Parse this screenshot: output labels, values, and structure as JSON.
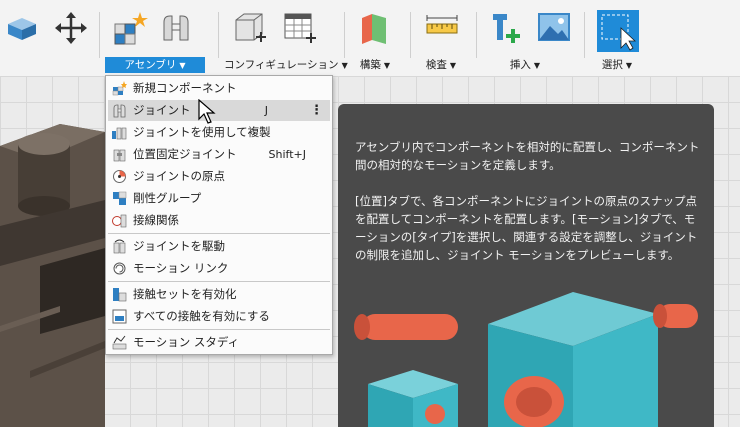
{
  "toolbar": {
    "groups": [
      {
        "label": "アセンブリ",
        "active": true
      },
      {
        "label": "コンフィギュレーション",
        "active": false
      },
      {
        "label": "構築",
        "active": false
      },
      {
        "label": "検査",
        "active": false
      },
      {
        "label": "挿入",
        "active": false
      },
      {
        "label": "選択",
        "active": false
      }
    ],
    "icons": [
      "new-body-icon",
      "move-icon",
      "new-component-icon",
      "joint-icon",
      "configuration-icon",
      "configuration-table-icon",
      "construct-icon",
      "measure-icon",
      "insert-derive-icon",
      "insert-image-icon",
      "select-window-icon"
    ]
  },
  "menu": {
    "items": [
      {
        "label": "新規コンポーネント",
        "shortcut": "",
        "icon": "new-component-icon"
      },
      {
        "label": "ジョイント",
        "shortcut": "J",
        "icon": "joint-icon"
      },
      {
        "label": "ジョイントを使用して複製",
        "shortcut": "",
        "icon": "duplicate-with-joints-icon"
      },
      {
        "label": "位置固定ジョイント",
        "shortcut": "Shift+J",
        "icon": "as-built-joint-icon"
      },
      {
        "label": "ジョイントの原点",
        "shortcut": "",
        "icon": "joint-origin-icon"
      },
      {
        "label": "剛性グループ",
        "shortcut": "",
        "icon": "rigid-group-icon"
      },
      {
        "label": "接線関係",
        "shortcut": "",
        "icon": "tangent-relationship-icon"
      },
      {
        "label": "ジョイントを駆動",
        "shortcut": "",
        "icon": "drive-joints-icon"
      },
      {
        "label": "モーション リンク",
        "shortcut": "",
        "icon": "motion-link-icon"
      },
      {
        "label": "接触セットを有効化",
        "shortcut": "",
        "icon": "enable-contact-sets-icon"
      },
      {
        "label": "すべての接触を有効にする",
        "shortcut": "",
        "icon": "enable-all-contact-icon"
      },
      {
        "label": "モーション スタディ",
        "shortcut": "",
        "icon": "motion-study-icon"
      }
    ]
  },
  "tooltip": {
    "paragraph1": "アセンブリ内でコンポーネントを相対的に配置し、コンポーネント間の相対的なモーションを定義します。",
    "paragraph2": "[位置]タブで、各コンポーネントにジョイントの原点のスナップ点を配置してコンポーネントを配置します。[モーション]タブで、モーションの[タイプ]を選択し、関連する設定を調整し、ジョイントの制限を追加し、ジョイント モーションをプレビューします。"
  },
  "colors": {
    "accent": "#1f8bd8",
    "tooltip_bg": "#4a4a4a",
    "cube": "#3fb8c6",
    "orange": "#e8664a"
  }
}
